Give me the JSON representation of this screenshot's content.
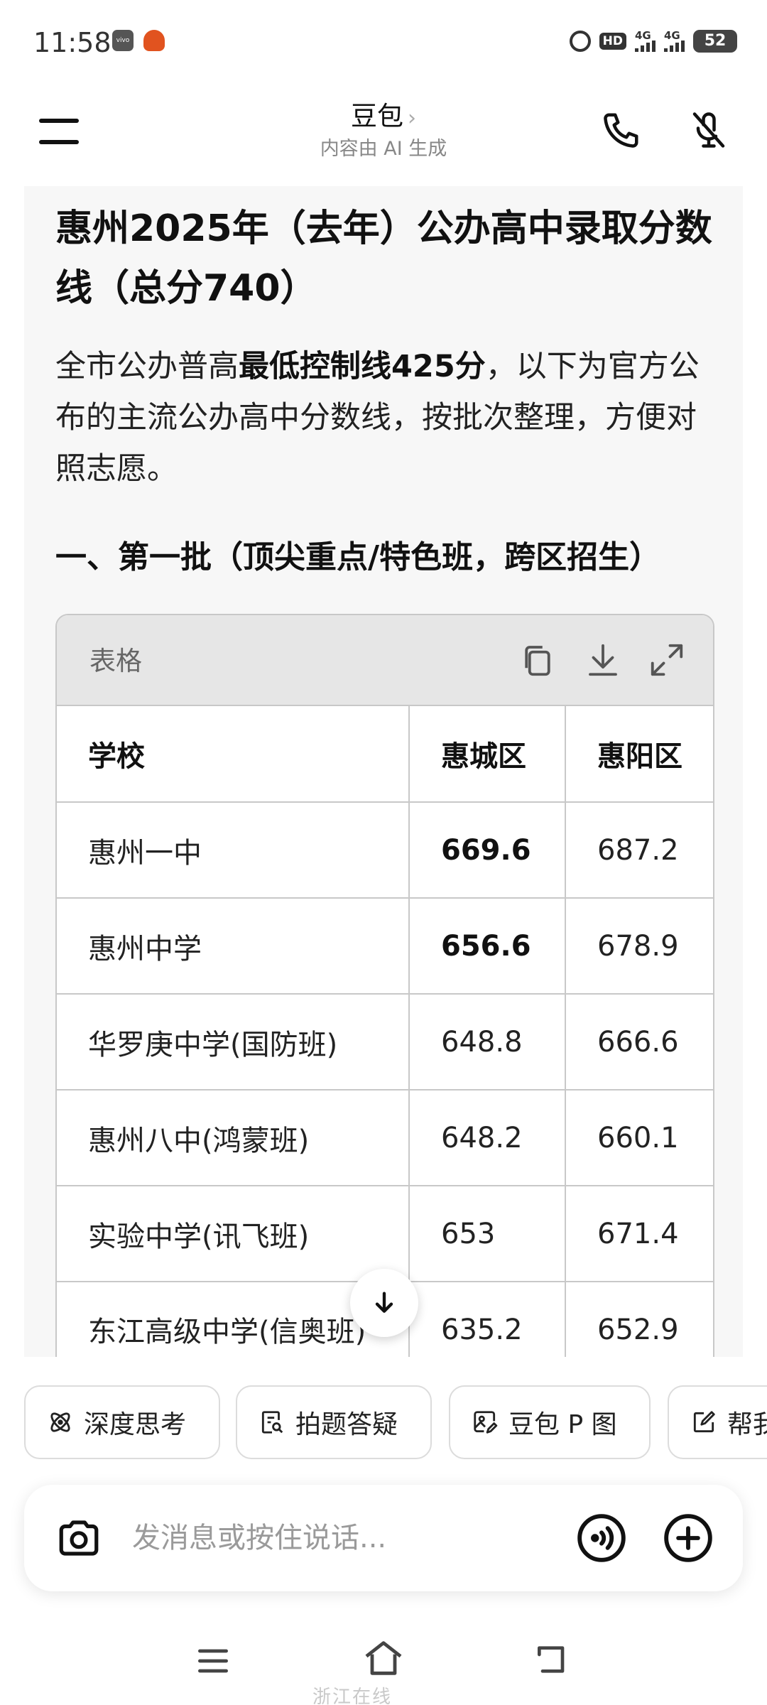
{
  "status_bar": {
    "time": "11:58",
    "hd_label": "HD",
    "signal_1_label": "4G",
    "signal_2_label": "4G",
    "battery": "52",
    "icons": [
      "vivo-app-icon",
      "game-app-icon",
      "alarm-icon",
      "hd-icon",
      "signal-icon",
      "signal-icon",
      "battery-icon"
    ]
  },
  "header": {
    "title": "豆包",
    "subtitle": "内容由 AI 生成",
    "icons": [
      "menu-icon",
      "chevron-right-icon",
      "phone-call-icon",
      "mute-icon"
    ]
  },
  "message": {
    "title": "惠州2025年（去年）公办高中录取分数线（总分740）",
    "para_pre": "全市公办普高",
    "para_bold": "最低控制线425分",
    "para_post": "，以下为官方公布的主流公办高中分数线，按批次整理，方便对照志愿。",
    "section_heading": "一、第一批（顶尖重点/特色班，跨区招生）",
    "table": {
      "label": "表格",
      "icons": [
        "copy-icon",
        "download-icon",
        "expand-icon"
      ],
      "headers": [
        "学校",
        "惠城区",
        "惠阳区"
      ],
      "rows": [
        [
          "惠州一中",
          "669.6",
          "687.2"
        ],
        [
          "惠州中学",
          "656.6",
          "678.9"
        ],
        [
          "华罗庚中学(国防班)",
          "648.8",
          "666.6"
        ],
        [
          "惠州八中(鸿蒙班)",
          "648.2",
          "660.1"
        ],
        [
          "实验中学(讯飞班)",
          "653",
          "671.4"
        ],
        [
          "东江高级中学(信奥班)",
          "635.2",
          "652.9"
        ]
      ]
    }
  },
  "chips": [
    {
      "label": "深度思考",
      "icon": "atom-icon"
    },
    {
      "label": "拍题答疑",
      "icon": "search-doc-icon"
    },
    {
      "label": "豆包 P 图",
      "icon": "image-edit-icon"
    },
    {
      "label": "帮我",
      "icon": "edit-icon"
    }
  ],
  "input": {
    "placeholder": "发消息或按住说话...",
    "icons": [
      "camera-icon",
      "voice-icon",
      "plus-icon"
    ]
  },
  "nav": {
    "icons": [
      "nav-menu-icon",
      "nav-home-icon",
      "nav-back-icon"
    ],
    "watermark": "浙江在线"
  },
  "colors": {
    "card_bg": "#f7f7f7",
    "table_header_bg": "#e6e6e6",
    "border": "#c8c8c8",
    "text": "#111111",
    "muted": "#888888"
  }
}
